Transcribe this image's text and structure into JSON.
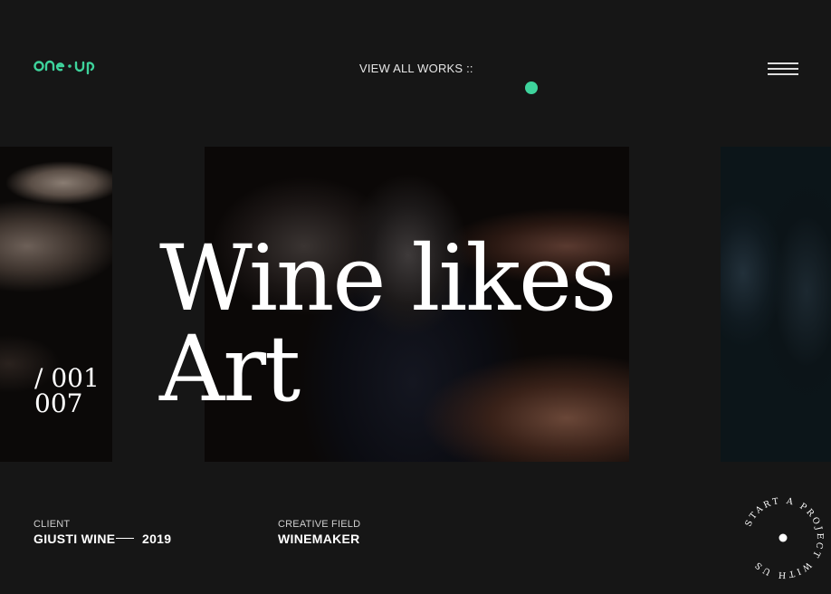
{
  "header": {
    "logo_text": "one-up",
    "nav_label": "VIEW ALL WORKS  ::",
    "menu_icon": "hamburger-icon"
  },
  "hero": {
    "title_line1": "Wine likes",
    "title_line2": "Art",
    "counter_current": "/ 001",
    "counter_total": "007"
  },
  "meta": {
    "client_label": "CLIENT",
    "client_value": "GIUSTI WINE",
    "year": "2019",
    "field_label": "CREATIVE FIELD",
    "field_value": "WINEMAKER"
  },
  "cta": {
    "circular_text": "START A PROJECT WITH US"
  },
  "colors": {
    "background": "#161616",
    "accent": "#3ed39c",
    "text": "#ffffff"
  }
}
